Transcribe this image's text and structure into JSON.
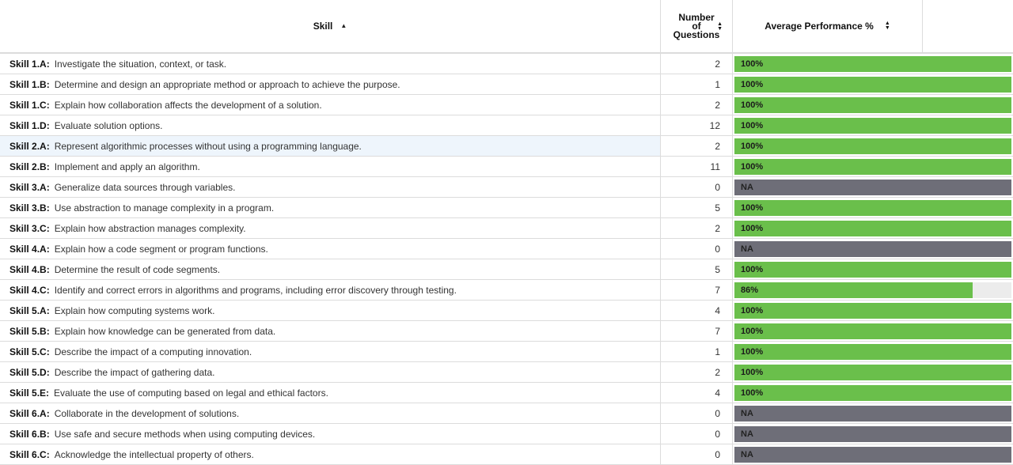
{
  "header": {
    "skill": "Skill",
    "num_line1": "Number",
    "num_line2": "of",
    "num_line3": "Questions",
    "avg": "Average Performance %"
  },
  "colors": {
    "bar": "#6abf4b",
    "na": "#6e6e78",
    "track": "#ececec",
    "highlight": "#eef5fc"
  },
  "rows": [
    {
      "code": "Skill 1.A:",
      "desc": "Investigate the situation, context, or task.",
      "num": "2",
      "perf": "100%",
      "fraction": 1.0
    },
    {
      "code": "Skill 1.B:",
      "desc": "Determine and design an appropriate method or approach to achieve the purpose.",
      "num": "1",
      "perf": "100%",
      "fraction": 1.0
    },
    {
      "code": "Skill 1.C:",
      "desc": "Explain how collaboration affects the development of a solution.",
      "num": "2",
      "perf": "100%",
      "fraction": 1.0
    },
    {
      "code": "Skill 1.D:",
      "desc": "Evaluate solution options.",
      "num": "12",
      "perf": "100%",
      "fraction": 1.0
    },
    {
      "code": "Skill 2.A:",
      "desc": "Represent algorithmic processes without using a programming language.",
      "num": "2",
      "perf": "100%",
      "fraction": 1.0,
      "highlight": true
    },
    {
      "code": "Skill 2.B:",
      "desc": "Implement and apply an algorithm.",
      "num": "11",
      "perf": "100%",
      "fraction": 1.0
    },
    {
      "code": "Skill 3.A:",
      "desc": "Generalize data sources through variables.",
      "num": "0",
      "perf": "NA",
      "fraction": null
    },
    {
      "code": "Skill 3.B:",
      "desc": "Use abstraction to manage complexity in a program.",
      "num": "5",
      "perf": "100%",
      "fraction": 1.0
    },
    {
      "code": "Skill 3.C:",
      "desc": "Explain how abstraction manages complexity.",
      "num": "2",
      "perf": "100%",
      "fraction": 1.0
    },
    {
      "code": "Skill 4.A:",
      "desc": "Explain how a code segment or program functions.",
      "num": "0",
      "perf": "NA",
      "fraction": null
    },
    {
      "code": "Skill 4.B:",
      "desc": "Determine the result of code segments.",
      "num": "5",
      "perf": "100%",
      "fraction": 1.0
    },
    {
      "code": "Skill 4.C:",
      "desc": "Identify and correct errors in algorithms and programs, including error discovery through testing.",
      "num": "7",
      "perf": "86%",
      "fraction": 0.86
    },
    {
      "code": "Skill 5.A:",
      "desc": "Explain how computing systems work.",
      "num": "4",
      "perf": "100%",
      "fraction": 1.0
    },
    {
      "code": "Skill 5.B:",
      "desc": "Explain how knowledge can be generated from data.",
      "num": "7",
      "perf": "100%",
      "fraction": 1.0
    },
    {
      "code": "Skill 5.C:",
      "desc": "Describe the impact of a computing innovation.",
      "num": "1",
      "perf": "100%",
      "fraction": 1.0
    },
    {
      "code": "Skill 5.D:",
      "desc": "Describe the impact of gathering data.",
      "num": "2",
      "perf": "100%",
      "fraction": 1.0
    },
    {
      "code": "Skill 5.E:",
      "desc": "Evaluate the use of computing based on legal and ethical factors.",
      "num": "4",
      "perf": "100%",
      "fraction": 1.0
    },
    {
      "code": "Skill 6.A:",
      "desc": "Collaborate in the development of solutions.",
      "num": "0",
      "perf": "NA",
      "fraction": null
    },
    {
      "code": "Skill 6.B:",
      "desc": "Use safe and secure methods when using computing devices.",
      "num": "0",
      "perf": "NA",
      "fraction": null
    },
    {
      "code": "Skill 6.C:",
      "desc": "Acknowledge the intellectual property of others.",
      "num": "0",
      "perf": "NA",
      "fraction": null
    }
  ]
}
